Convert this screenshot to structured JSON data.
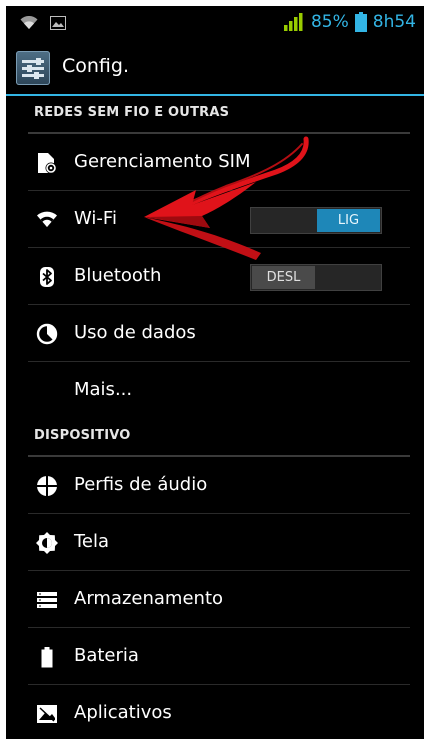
{
  "status_bar": {
    "battery_percent": "85%",
    "time": "8h54",
    "accent_color": "#33b5e5",
    "signal_color": "#99cc00",
    "icons": [
      "wifi-icon",
      "image-notification-icon",
      "signal-icon",
      "battery-icon"
    ]
  },
  "action_bar": {
    "title": "Config.",
    "icon": "settings-app-icon"
  },
  "sections": {
    "wireless": "REDES SEM FIO E OUTRAS",
    "device": "DISPOSITIVO"
  },
  "items": {
    "sim": {
      "label": "Gerenciamento SIM",
      "icon": "sim-card-icon"
    },
    "wifi": {
      "label": "Wi-Fi",
      "icon": "wifi-icon",
      "toggle": "LIG",
      "enabled": true
    },
    "bluetooth": {
      "label": "Bluetooth",
      "icon": "bluetooth-icon",
      "toggle": "DESL",
      "enabled": false
    },
    "data": {
      "label": "Uso de dados",
      "icon": "data-usage-icon"
    },
    "more": {
      "label": "Mais..."
    },
    "audio": {
      "label": "Perfis de áudio",
      "icon": "audio-profiles-icon"
    },
    "display": {
      "label": "Tela",
      "icon": "display-icon"
    },
    "storage": {
      "label": "Armazenamento",
      "icon": "storage-icon"
    },
    "battery": {
      "label": "Bateria",
      "icon": "battery-icon"
    },
    "apps": {
      "label": "Aplicativos",
      "icon": "apps-icon"
    }
  },
  "annotation": {
    "color": "#e0131a",
    "points_to": "Wi-Fi"
  }
}
